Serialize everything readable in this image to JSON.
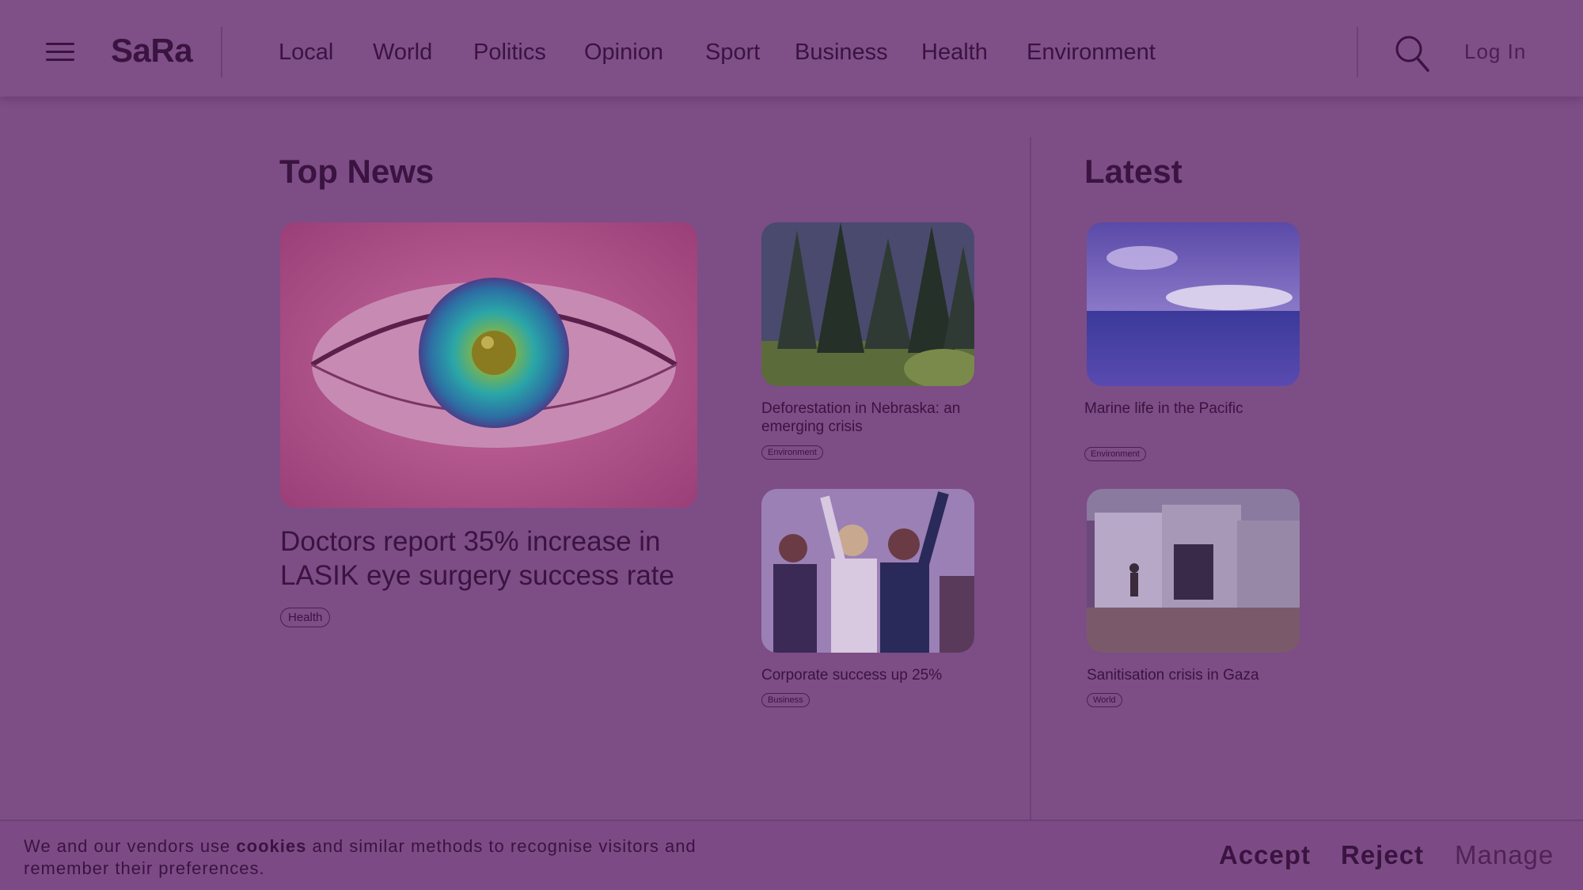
{
  "header": {
    "logo": "SaRa",
    "nav": [
      "Local",
      "World",
      "Politics",
      "Opinion",
      "Sport",
      "Business",
      "Health",
      "Environment"
    ],
    "login_label": "Log In"
  },
  "top_news": {
    "title": "Top News",
    "main": {
      "headline": "Doctors report 35% increase in LASIK eye surgery success rate",
      "tag": "Health"
    },
    "side": [
      {
        "title": "Deforestation in Nebraska: an emerging crisis",
        "tag": "Environment"
      },
      {
        "title": "Corporate success up 25%",
        "tag": "Business"
      }
    ]
  },
  "latest": {
    "title": "Latest",
    "items": [
      {
        "title": "Marine life in the Pacific",
        "tag": "Environment"
      },
      {
        "title": "Sanitisation crisis in Gaza",
        "tag": "World"
      }
    ]
  },
  "cookie_banner": {
    "text_before": "We and our vendors use ",
    "cookies_link": "cookies",
    "text_after": " and similar methods to recognise visitors and remember their preferences.",
    "accept_label": "Accept",
    "reject_label": "Reject",
    "manage_label": "Manage"
  },
  "icons": {
    "menu": "hamburger-menu-icon",
    "search": "search-icon"
  }
}
